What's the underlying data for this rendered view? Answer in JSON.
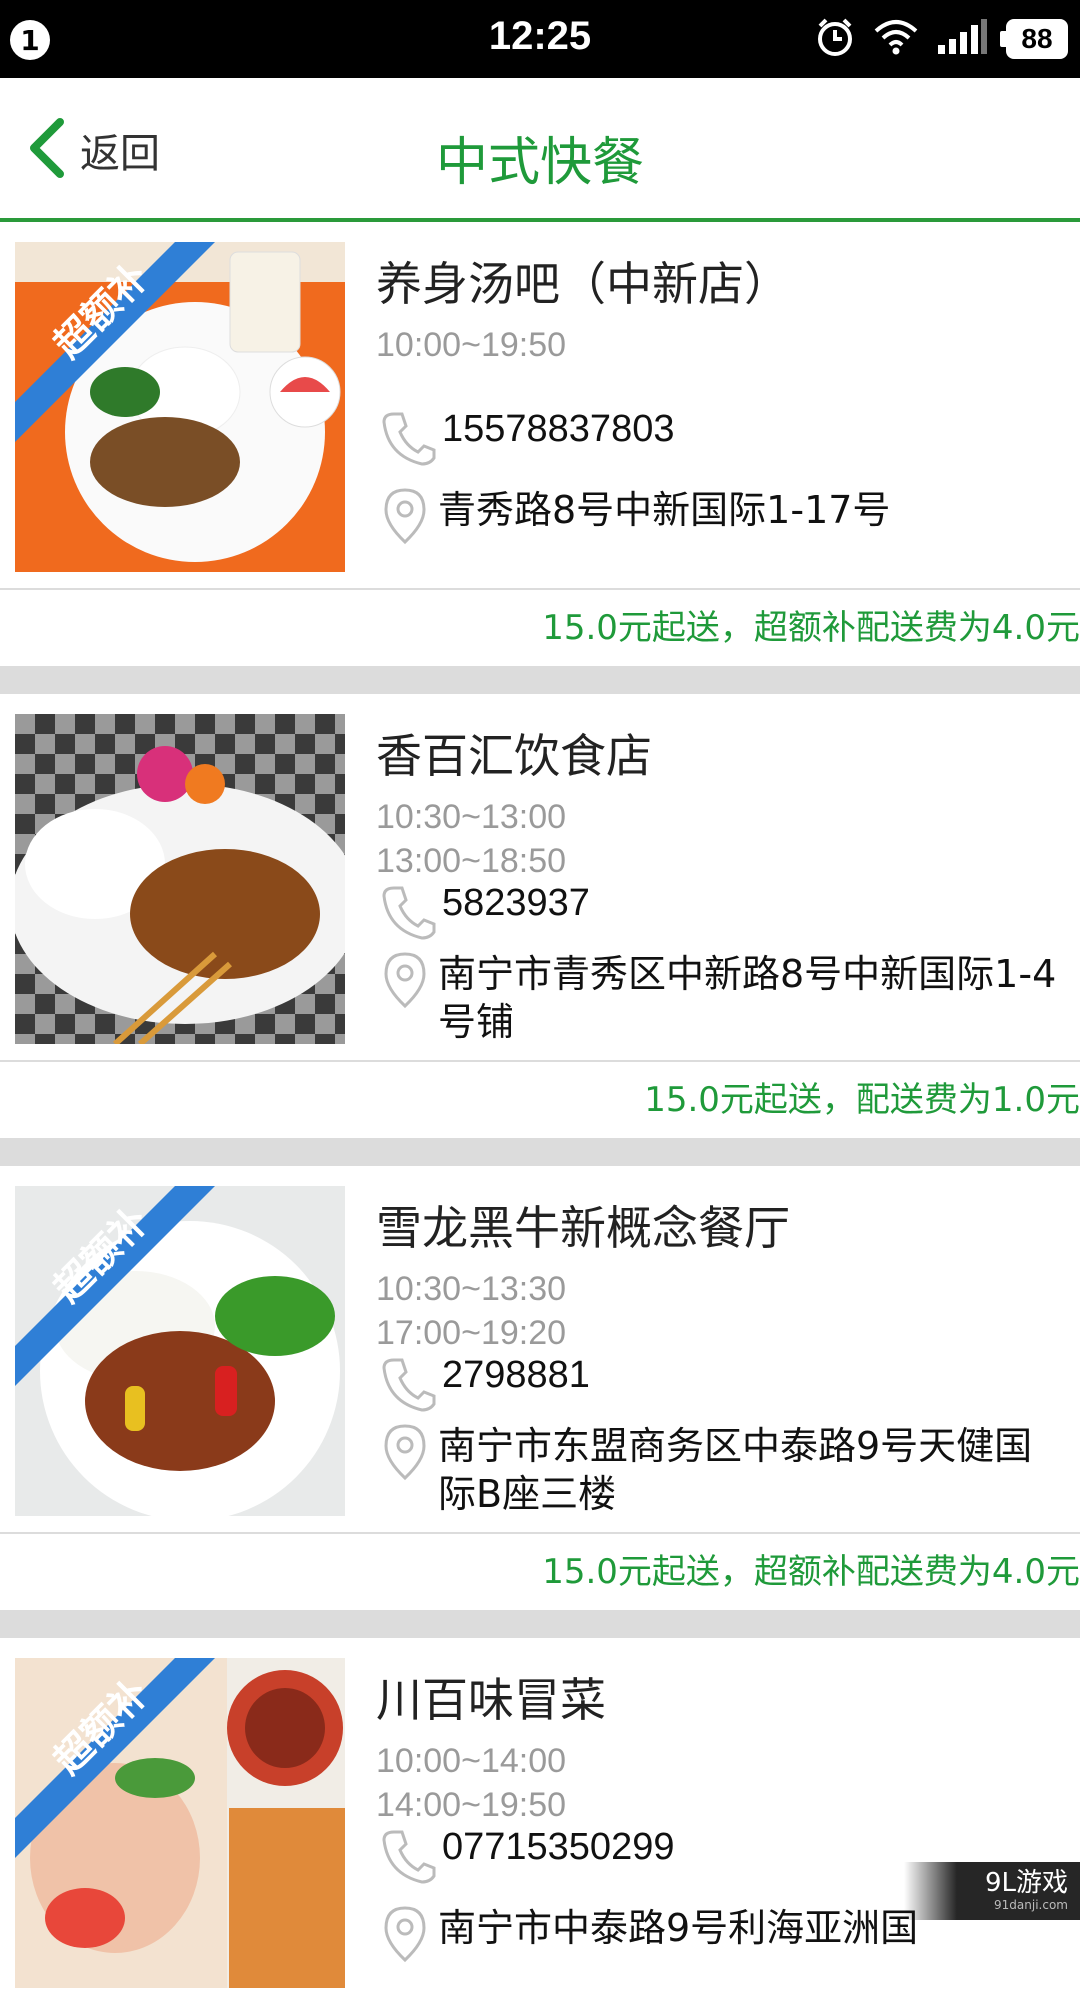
{
  "status_bar": {
    "notification_count": "1",
    "time": "12:25",
    "battery": "88",
    "icons": [
      "alarm-icon",
      "wifi-icon",
      "signal-icon",
      "battery-icon"
    ]
  },
  "header": {
    "back_label": "返回",
    "title": "中式快餐",
    "accent": "#1f9a3a"
  },
  "restaurants": [
    {
      "name": "养身汤吧（中新店）",
      "hours": [
        "10:00~19:50"
      ],
      "phone": "15578837803",
      "address": "青秀路8号中新国际1-17号",
      "delivery": "15.0元起送，超额补配送费为4.0元",
      "badge": "超额补"
    },
    {
      "name": "香百汇饮食店",
      "hours": [
        "10:30~13:00",
        "13:00~18:50"
      ],
      "phone": "5823937",
      "address": "南宁市青秀区中新路8号中新国际1-4号铺",
      "delivery": "15.0元起送，配送费为1.0元",
      "badge": ""
    },
    {
      "name": "雪龙黑牛新概念餐厅",
      "hours": [
        "10:30~13:30",
        "17:00~19:20"
      ],
      "phone": "2798881",
      "address": "南宁市东盟商务区中泰路9号天健国际B座三楼",
      "delivery": "15.0元起送，超额补配送费为4.0元",
      "badge": "超额补"
    },
    {
      "name": "川百味冒菜",
      "hours": [
        "10:00~14:00",
        "14:00~19:50"
      ],
      "phone": "07715350299",
      "address": "南宁市中泰路9号利海亚洲国",
      "delivery": "",
      "badge": "超额补"
    }
  ],
  "watermark": {
    "brand": "9L游戏",
    "site": "91danji.com"
  }
}
